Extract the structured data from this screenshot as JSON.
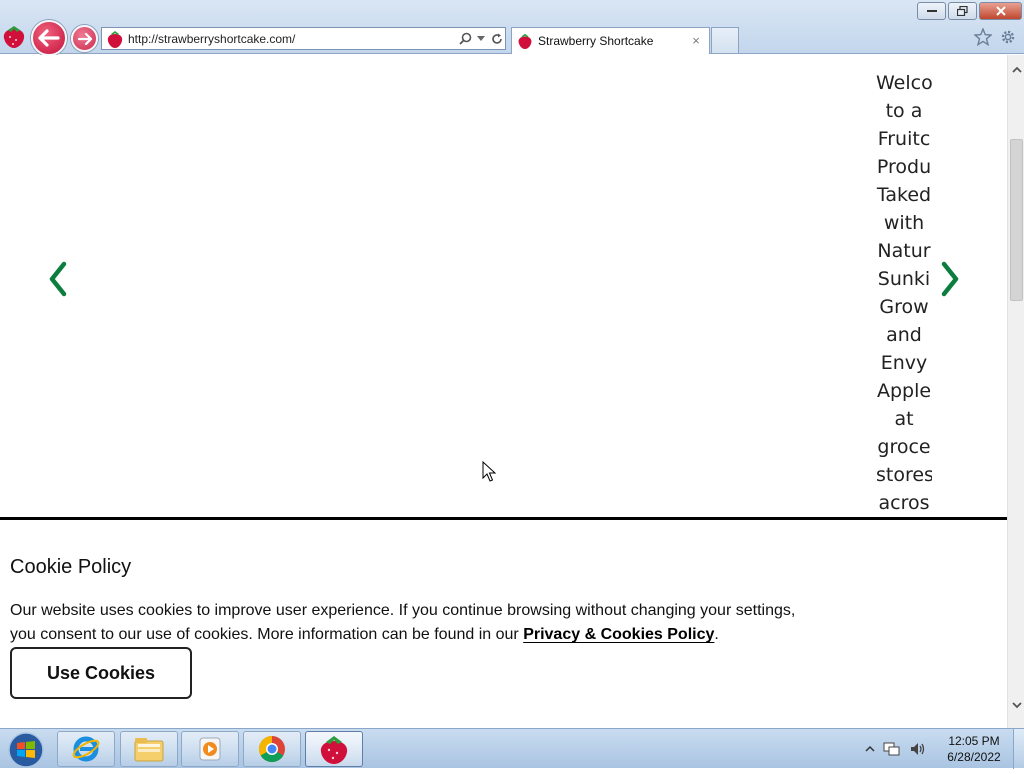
{
  "browser": {
    "address_url": "http://strawberryshortcake.com/",
    "tab_label": "Strawberry Shortcake",
    "tab_close": "×"
  },
  "page": {
    "slide_text_lines": [
      "Welco",
      "to a",
      "Fruitc",
      "Produ",
      "Taked",
      "with",
      "Natur",
      "Sunki",
      "Grow",
      "and",
      "Envy",
      "Apple",
      "at",
      "groce",
      "stores",
      "acros"
    ]
  },
  "cookie_banner": {
    "title": "Cookie Policy",
    "text_before": "Our website uses cookies to improve user experience. If you continue browsing without changing your settings, you consent to our use of cookies. More information can be found in our ",
    "link_text": "Privacy & Cookies Policy",
    "text_after": ".",
    "button_label": "Use Cookies"
  },
  "taskbar": {
    "clock_time": "12:05 PM",
    "clock_date": "6/28/2022"
  },
  "colors": {
    "carousel_arrow": "#0b7d3e",
    "brand_red": "#d0103a"
  }
}
